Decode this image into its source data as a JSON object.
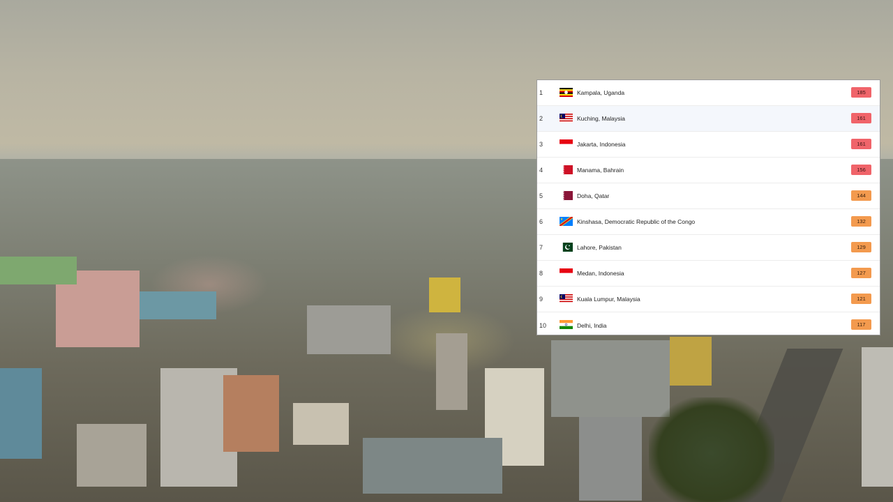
{
  "ranking": {
    "rows": [
      {
        "rank": "1",
        "city": "Kampala, Uganda",
        "aqi": "185",
        "level": "red",
        "flag": "uganda-flag-icon"
      },
      {
        "rank": "2",
        "city": "Kuching, Malaysia",
        "aqi": "161",
        "level": "red",
        "flag": "malaysia-flag-icon"
      },
      {
        "rank": "3",
        "city": "Jakarta, Indonesia",
        "aqi": "161",
        "level": "red",
        "flag": "indonesia-flag-icon"
      },
      {
        "rank": "4",
        "city": "Manama, Bahrain",
        "aqi": "156",
        "level": "red",
        "flag": "bahrain-flag-icon"
      },
      {
        "rank": "5",
        "city": "Doha, Qatar",
        "aqi": "144",
        "level": "orange",
        "flag": "qatar-flag-icon"
      },
      {
        "rank": "6",
        "city": "Kinshasa, Democratic Republic of the Congo",
        "aqi": "132",
        "level": "orange",
        "flag": "dr-congo-flag-icon"
      },
      {
        "rank": "7",
        "city": "Lahore, Pakistan",
        "aqi": "129",
        "level": "orange",
        "flag": "pakistan-flag-icon"
      },
      {
        "rank": "8",
        "city": "Medan, Indonesia",
        "aqi": "127",
        "level": "orange",
        "flag": "indonesia-flag-icon"
      },
      {
        "rank": "9",
        "city": "Kuala Lumpur, Malaysia",
        "aqi": "121",
        "level": "orange",
        "flag": "malaysia-flag-icon"
      },
      {
        "rank": "10",
        "city": "Delhi, India",
        "aqi": "117",
        "level": "orange",
        "flag": "india-flag-icon"
      }
    ]
  },
  "colors": {
    "unhealthy": "#f0646a",
    "unhealthy_sensitive": "#f39a4e",
    "highlight_row": "#f4f7fc"
  }
}
